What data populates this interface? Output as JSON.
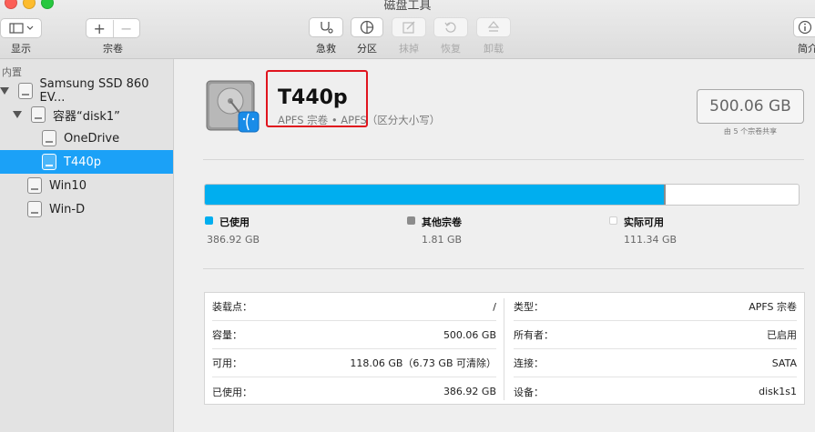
{
  "window": {
    "title": "磁盘工具"
  },
  "toolbar": {
    "view_label": "显示",
    "volume_label": "宗卷",
    "firstaid_label": "急救",
    "partition_label": "分区",
    "erase_label": "抹掉",
    "restore_label": "恢复",
    "unmount_label": "卸载",
    "info_label": "简介"
  },
  "sidebar": {
    "header": "内置",
    "items": [
      {
        "label": "Samsung SSD 860 EV..."
      },
      {
        "label": "容器“disk1”"
      },
      {
        "label": "OneDrive"
      },
      {
        "label": "T440p"
      },
      {
        "label": "Win10"
      },
      {
        "label": "Win-D"
      }
    ]
  },
  "volume": {
    "name": "T440p",
    "subtitle": "APFS 宗卷 • APFS（区分大小写）",
    "capacity": "500.06 GB",
    "shared_note": "由 5 个宗卷共享"
  },
  "usage": {
    "used_fraction": 0.7737,
    "other_fraction": 0.0036,
    "colors": {
      "used": "#00aeef",
      "other": "#8c8c8c",
      "free": "#ffffff"
    },
    "legend": [
      {
        "label": "已使用",
        "value": "386.92 GB",
        "color": "#00aeef"
      },
      {
        "label": "其他宗卷",
        "value": "1.81 GB",
        "color": "#8c8c8c"
      },
      {
        "label": "实际可用",
        "value": "111.34 GB",
        "color": "#ffffff"
      }
    ]
  },
  "info": {
    "left": [
      {
        "key": "装载点：",
        "value": "/"
      },
      {
        "key": "容量：",
        "value": "500.06 GB"
      },
      {
        "key": "可用：",
        "value": "118.06 GB（6.73 GB 可清除）"
      },
      {
        "key": "已使用：",
        "value": "386.92 GB"
      }
    ],
    "right": [
      {
        "key": "类型：",
        "value": "APFS 宗卷"
      },
      {
        "key": "所有者：",
        "value": "已启用"
      },
      {
        "key": "连接：",
        "value": "SATA"
      },
      {
        "key": "设备：",
        "value": "disk1s1"
      }
    ]
  },
  "annotation": {
    "color": "#e0141e"
  }
}
